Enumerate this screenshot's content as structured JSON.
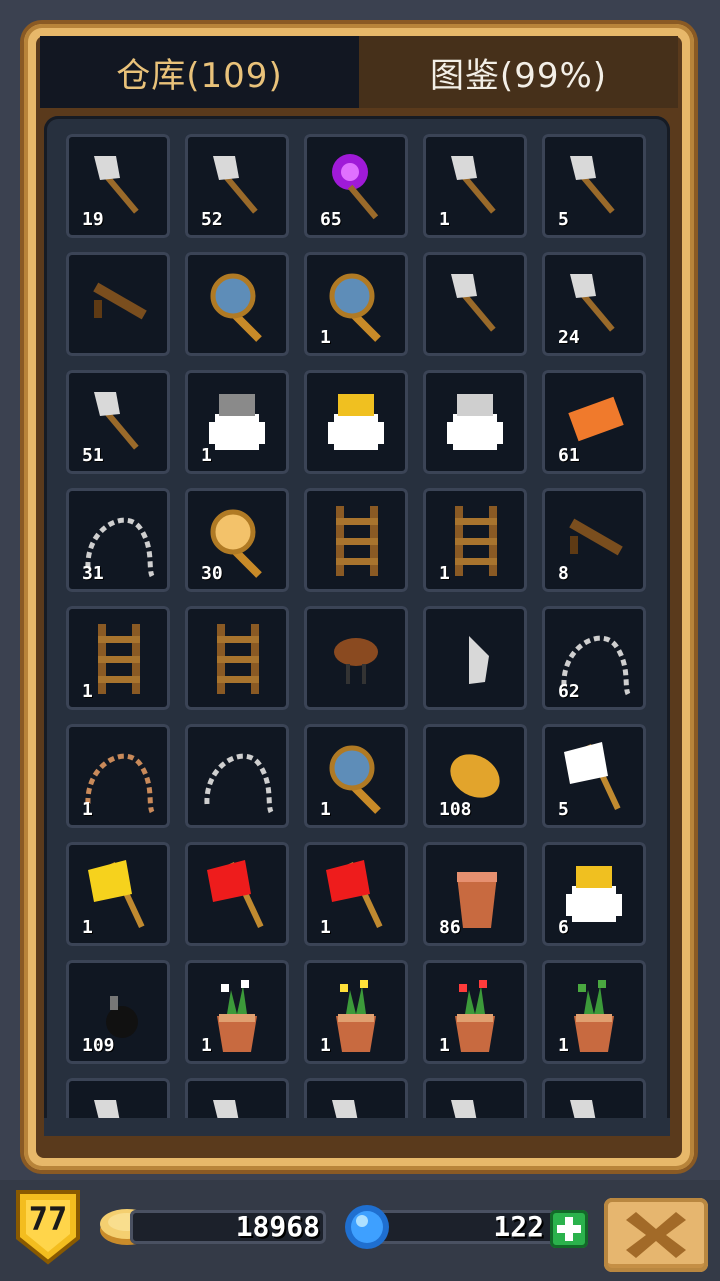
{
  "tabs": [
    {
      "label": "仓库(109)",
      "active": true
    },
    {
      "label": "图鉴(99%)",
      "active": false
    }
  ],
  "items": [
    {
      "icon": "net-icon",
      "count": "19"
    },
    {
      "icon": "axe-icon",
      "count": "52"
    },
    {
      "icon": "magic-staff-icon",
      "count": "65"
    },
    {
      "icon": "arrow-icon",
      "count": "1"
    },
    {
      "icon": "purple-arrow-icon",
      "count": "5"
    },
    {
      "icon": "wooden-bench-icon",
      "count": ""
    },
    {
      "icon": "small-magnifier-icon",
      "count": ""
    },
    {
      "icon": "magnifier-icon",
      "count": "1"
    },
    {
      "icon": "grappling-hook-icon",
      "count": ""
    },
    {
      "icon": "gold-arrow-icon",
      "count": "24"
    },
    {
      "icon": "torch-icon",
      "count": "51"
    },
    {
      "icon": "gray-crown-sack-icon",
      "count": "1"
    },
    {
      "icon": "gold-crown-sack-icon",
      "count": ""
    },
    {
      "icon": "silver-crown-sack-icon",
      "count": ""
    },
    {
      "icon": "brick-icon",
      "count": "61"
    },
    {
      "icon": "chain-icon",
      "count": "31"
    },
    {
      "icon": "golden-magnifier-icon",
      "count": "30"
    },
    {
      "icon": "ladder-short-icon",
      "count": ""
    },
    {
      "icon": "ladder-tilted-icon",
      "count": "1"
    },
    {
      "icon": "wooden-plank-icon",
      "count": "8"
    },
    {
      "icon": "wooden-ladder-icon",
      "count": "1"
    },
    {
      "icon": "wooden-fence-icon",
      "count": ""
    },
    {
      "icon": "cooking-pot-icon",
      "count": ""
    },
    {
      "icon": "stone-shard-icon",
      "count": ""
    },
    {
      "icon": "whip-icon",
      "count": "62"
    },
    {
      "icon": "rope-icon",
      "count": "1"
    },
    {
      "icon": "iron-chain-icon",
      "count": ""
    },
    {
      "icon": "hand-lens-icon",
      "count": "1"
    },
    {
      "icon": "golden-leaf-icon",
      "count": "108"
    },
    {
      "icon": "white-flag-icon",
      "count": "5"
    },
    {
      "icon": "yellow-flag-icon",
      "count": "1"
    },
    {
      "icon": "red-flag-icon",
      "count": ""
    },
    {
      "icon": "hammer-sickle-flag-icon",
      "count": "1"
    },
    {
      "icon": "clay-pot-icon",
      "count": "86"
    },
    {
      "icon": "gold-sack-icon",
      "count": "6"
    },
    {
      "icon": "bomb-icon",
      "count": "109"
    },
    {
      "icon": "white-flower-pot-icon",
      "count": "1"
    },
    {
      "icon": "yellow-flower-pot-icon",
      "count": "1"
    },
    {
      "icon": "red-flower-pot-icon",
      "count": "1"
    },
    {
      "icon": "aloe-pot-icon",
      "count": "1"
    },
    {
      "icon": "bread-icon",
      "count": ""
    },
    {
      "icon": "cheese-icon",
      "count": ""
    },
    {
      "icon": "boot-icon",
      "count": ""
    },
    {
      "icon": "dagger-icon",
      "count": ""
    },
    {
      "icon": "mushroom-icon",
      "count": ""
    }
  ],
  "hud": {
    "level": "77",
    "gold": "18968",
    "gems": "122"
  },
  "colors": {
    "accent": "#e9c27a",
    "frame": "#e7b86a",
    "slot_bg": "#101722",
    "gem_blue": "#2e8ff0",
    "plus_green": "#2bb24c"
  }
}
